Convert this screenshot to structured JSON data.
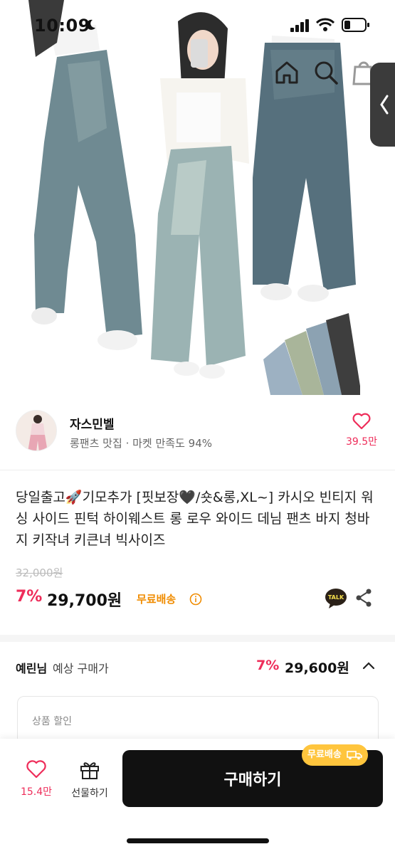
{
  "status_bar": {
    "time": "10:09"
  },
  "seller": {
    "name": "자스민벨",
    "tagline": "롱팬츠 맛집",
    "satisfaction": "마켓 만족도 94%",
    "likes": "39.5만"
  },
  "product": {
    "title": "당일출고🚀기모추가 [핏보장🖤/숏&롱,XL~] 카시오 빈티지 워싱 사이드 핀턱 하이웨스트 롱 로우 와이드 데님 팬츠 바지 청바지 키작녀 키큰녀 빅사이즈",
    "original_price": "32,000원",
    "discount": "7%",
    "price": "29,700원",
    "shipping": "무료배송",
    "talk_label": "TALK"
  },
  "expected": {
    "user": "예린님",
    "label": "예상 구매가",
    "discount": "7%",
    "price": "29,600원"
  },
  "discount_box": {
    "label": "상품 할인"
  },
  "bottom_bar": {
    "likes": "15.4만",
    "gift_label": "선물하기",
    "buy_label": "구매하기",
    "ship_badge": "무료배송"
  },
  "colors": {
    "accent": "#ee2d5a",
    "shipping": "#f08c00",
    "badge": "#ffc53d",
    "button": "#111111"
  }
}
